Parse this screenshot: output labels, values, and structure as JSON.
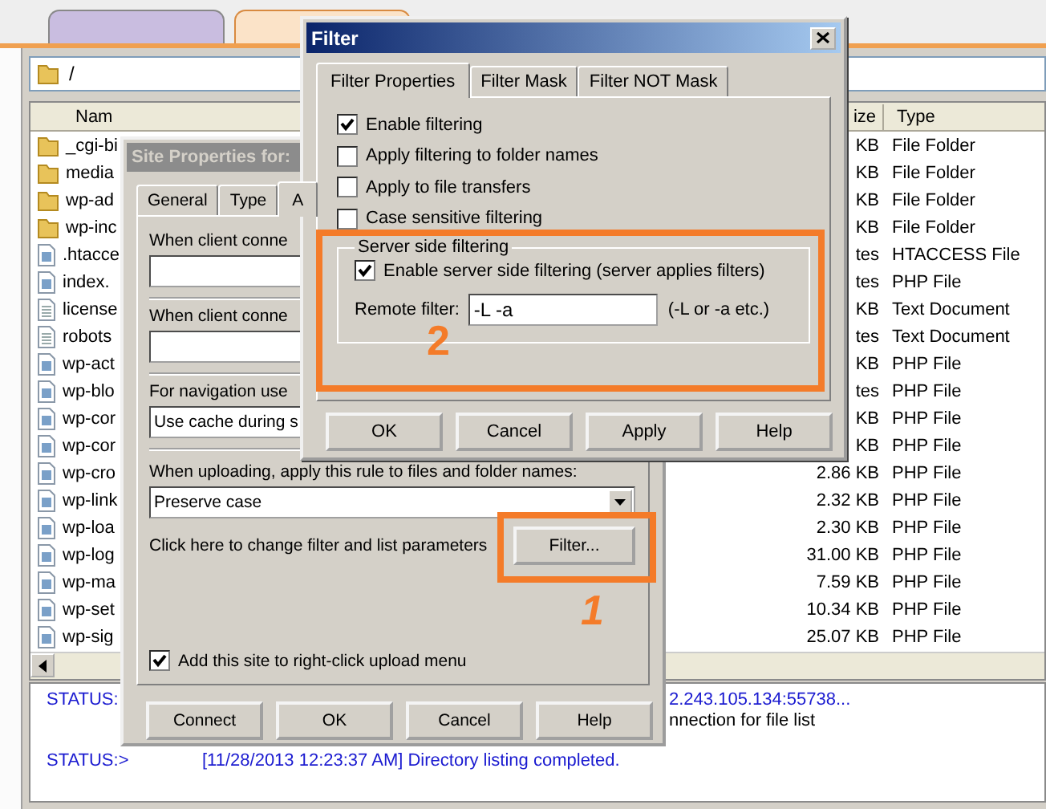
{
  "main_window": {
    "tabs": [
      {
        "selected": false
      },
      {
        "selected": true
      }
    ],
    "path": "/",
    "columns": [
      "Nam",
      "ize",
      "Type"
    ],
    "rows": [
      {
        "kind": "folder",
        "name": "_cgi-bi",
        "size": "KB",
        "type": "File Folder"
      },
      {
        "kind": "folder",
        "name": "media",
        "size": "KB",
        "type": "File Folder"
      },
      {
        "kind": "folder",
        "name": "wp-ad",
        "size": "KB",
        "type": "File Folder"
      },
      {
        "kind": "folder",
        "name": "wp-inc",
        "size": "KB",
        "type": "File Folder"
      },
      {
        "kind": "file",
        "name": ".htacce",
        "size": "tes",
        "type": "HTACCESS File"
      },
      {
        "kind": "file",
        "name": "index.",
        "size": "tes",
        "type": "PHP File"
      },
      {
        "kind": "text",
        "name": "license",
        "size": "KB",
        "type": "Text Document"
      },
      {
        "kind": "text",
        "name": "robots",
        "size": "tes",
        "type": "Text Document"
      },
      {
        "kind": "file",
        "name": "wp-act",
        "size": "KB",
        "type": "PHP File"
      },
      {
        "kind": "file",
        "name": "wp-blo",
        "size": "tes",
        "type": "PHP File"
      },
      {
        "kind": "file",
        "name": "wp-cor",
        "size": "KB",
        "type": "PHP File"
      },
      {
        "kind": "file",
        "name": "wp-cor",
        "size": "KB",
        "type": "PHP File"
      },
      {
        "kind": "file",
        "name": "wp-cro",
        "size": "2.86 KB",
        "type": "PHP File"
      },
      {
        "kind": "file",
        "name": "wp-link",
        "size": "2.32 KB",
        "type": "PHP File"
      },
      {
        "kind": "file",
        "name": "wp-loa",
        "size": "2.30 KB",
        "type": "PHP File"
      },
      {
        "kind": "file",
        "name": "wp-log",
        "size": "31.00 KB",
        "type": "PHP File"
      },
      {
        "kind": "file",
        "name": "wp-ma",
        "size": "7.59 KB",
        "type": "PHP File"
      },
      {
        "kind": "file",
        "name": "wp-set",
        "size": "10.34 KB",
        "type": "PHP File"
      },
      {
        "kind": "file",
        "name": "wp-sig",
        "size": "25.07 KB",
        "type": "PHP File"
      }
    ],
    "status_lines": [
      {
        "label": "STATUS:",
        "text": "2.243.105.134:55738...",
        "color": "#1a1ad0",
        "covered": true
      },
      {
        "text": "nnection for file list",
        "color": "#000000",
        "covered": true
      },
      {
        "label": "STATUS:>",
        "text": "[11/28/2013 12:23:37 AM] Directory listing completed.",
        "color": "#1a1ad0",
        "covered": false
      }
    ]
  },
  "site_properties": {
    "title": "Site Properties for:",
    "active": false,
    "tabs": [
      {
        "label": "General",
        "selected": false
      },
      {
        "label": "Type",
        "selected": false
      },
      {
        "label": "A",
        "selected": true
      }
    ],
    "sections": [
      {
        "kind": "field",
        "label": "When client conne"
      },
      {
        "kind": "field",
        "label": "When client conne"
      },
      {
        "kind": "field",
        "label": "For navigation use",
        "value": "Use cache during s"
      },
      {
        "kind": "select",
        "label": "When uploading, apply this rule to files and folder names:",
        "value": "Preserve case"
      }
    ],
    "filter_prompt": "Click here to change filter and list parameters",
    "filter_button": "Filter...",
    "upload_menu": {
      "label": "Add this site to right-click upload menu",
      "checked": true
    },
    "buttons": [
      "Connect",
      "OK",
      "Cancel",
      "Help"
    ]
  },
  "filter_dialog": {
    "title": "Filter",
    "active": true,
    "tabs": [
      {
        "label": "Filter Properties",
        "selected": true
      },
      {
        "label": "Filter Mask",
        "selected": false
      },
      {
        "label": "Filter NOT Mask",
        "selected": false
      }
    ],
    "options": [
      {
        "label": "Enable filtering",
        "checked": true
      },
      {
        "label": "Apply filtering to folder names",
        "checked": false
      },
      {
        "label": "Apply to file transfers",
        "checked": false
      },
      {
        "label": "Case sensitive filtering",
        "checked": false
      }
    ],
    "server_side": {
      "title": "Server side filtering",
      "enable": {
        "label": "Enable server side filtering (server applies filters)",
        "checked": true
      },
      "remote_label": "Remote filter:",
      "remote_value": "-L -a",
      "hint": "(-L or -a etc.)"
    },
    "buttons": [
      "OK",
      "Cancel",
      "Apply",
      "Help"
    ]
  },
  "annotations": [
    {
      "number": "2"
    },
    {
      "number": "1"
    }
  ]
}
